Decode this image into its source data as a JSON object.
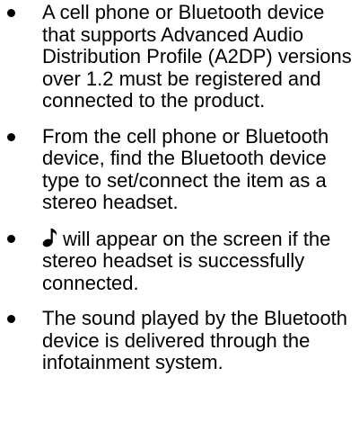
{
  "bullets": [
    {
      "text": "A cell phone or Bluetooth device that supports Advanced Audio Distribution Profile (A2DP) versions over 1.2 must be registered and connected to the product."
    },
    {
      "text": "From the cell phone or Bluetooth device, find the Bluetooth device type to set/connect the item as a stereo headset."
    },
    {
      "icon": "music-note-icon",
      "text": "will appear on the screen if the stereo headset is successfully connected."
    },
    {
      "text": "The sound played by the Bluetooth device is delivered through the infotainment system."
    }
  ]
}
